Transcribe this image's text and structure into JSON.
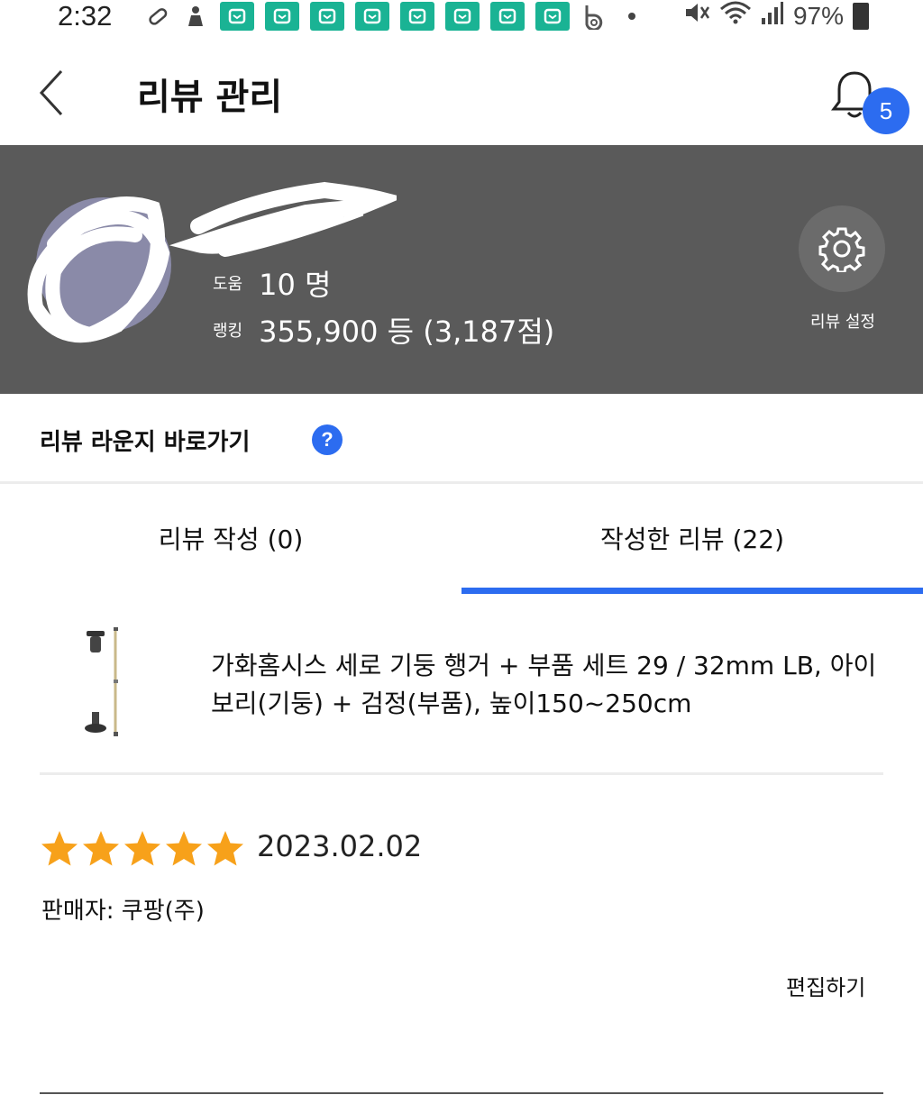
{
  "status_bar": {
    "time": "2:32",
    "battery": "97%",
    "icons_left": [
      "pill-icon",
      "person-icon",
      "app-icon",
      "app-icon",
      "app-icon",
      "app-icon",
      "app-icon",
      "app-icon",
      "app-icon",
      "app-icon",
      "b-app-icon",
      "dot-icon"
    ],
    "icons_right": [
      "mute-icon",
      "wifi-icon",
      "signal-icon",
      "battery-icon"
    ]
  },
  "header": {
    "title": "리뷰 관리",
    "notification_count": "5"
  },
  "profile": {
    "help_label": "도움",
    "help_value": "10 명",
    "rank_label": "랭킹",
    "rank_value": "355,900 등 (3,187점)",
    "settings_label": "리뷰 설정"
  },
  "lounge": {
    "link_label": "리뷰 라운지 바로가기",
    "help_glyph": "?"
  },
  "tabs": [
    {
      "label": "리뷰 작성 (0)",
      "active": false
    },
    {
      "label": "작성한 리뷰 (22)",
      "active": true
    }
  ],
  "product": {
    "name": "가화홈시스 세로 기둥 행거 + 부품 세트 29 / 32mm LB, 아이보리(기둥) + 검정(부품), 높이150~250cm"
  },
  "review": {
    "rating": 5,
    "date": "2023.02.02",
    "seller": "판매자: 쿠팡(주)",
    "edit_label": "편집하기"
  },
  "colors": {
    "accent": "#2c6cf0",
    "profile_bg": "#5a5a5a",
    "star": "#f7a11a",
    "badge_green": "#1ab394"
  }
}
